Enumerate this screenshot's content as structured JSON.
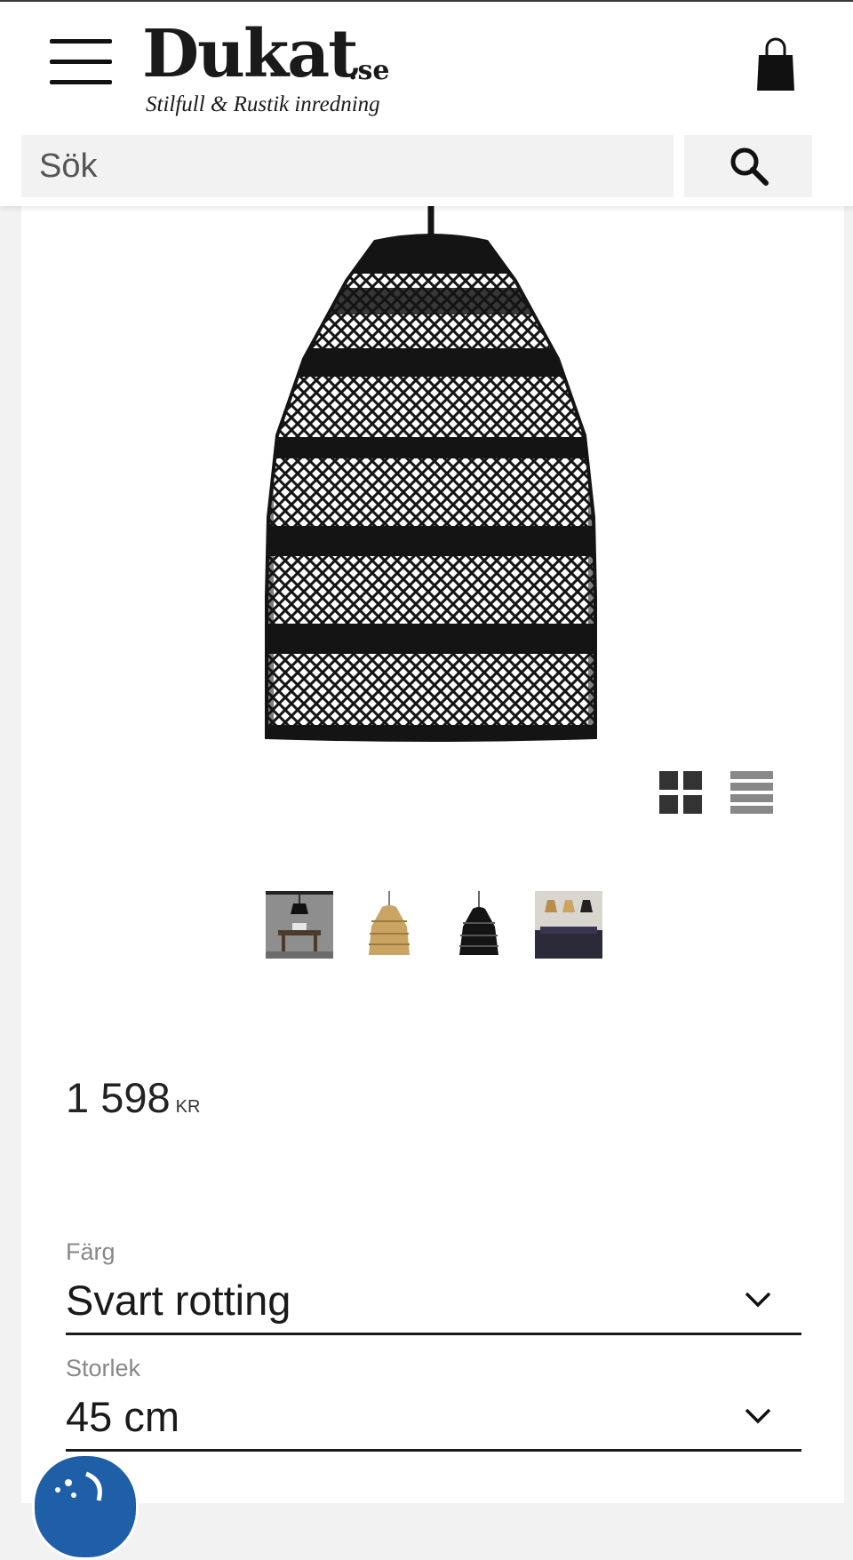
{
  "header": {
    "logo_main": "Dukat",
    "logo_tld": ".se",
    "logo_tagline": "Stilfull & Rustik inredning",
    "menu_icon": "hamburger-menu-icon",
    "cart_icon": "shopping-bag-icon"
  },
  "search": {
    "placeholder": "Sök",
    "button_icon": "search-icon"
  },
  "gallery": {
    "main_image_alt": "black rattan pendant lamp",
    "view_toggles": [
      "grid-view-icon",
      "list-view-icon"
    ],
    "thumbnails": [
      {
        "name": "thumbnail-room-black-lamp"
      },
      {
        "name": "thumbnail-natural-rattan"
      },
      {
        "name": "thumbnail-black-rattan"
      },
      {
        "name": "thumbnail-dining-room"
      }
    ]
  },
  "product": {
    "price": "1 598",
    "currency": "KR"
  },
  "options": {
    "color": {
      "label": "Färg",
      "value": "Svart rotting"
    },
    "size": {
      "label": "Storlek",
      "value": "45 cm"
    }
  },
  "colors": {
    "brand_text": "#1a1a1a",
    "badge_blue": "#1f5fa8",
    "lamp": "#141414",
    "rattan_natural": "#c9a463"
  }
}
